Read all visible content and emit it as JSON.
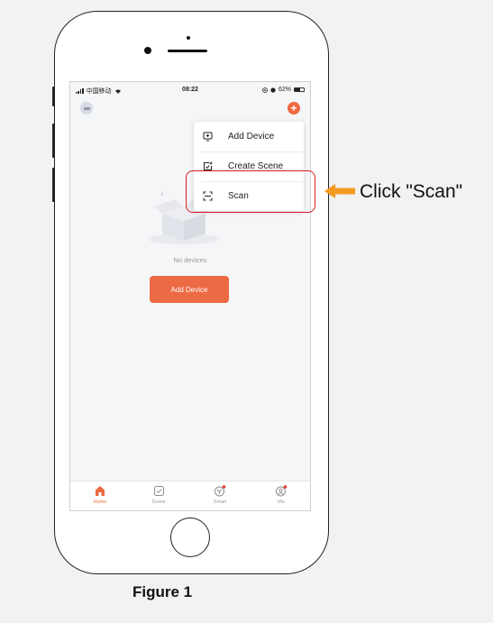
{
  "status_bar": {
    "carrier": "中国移动",
    "time": "08:22",
    "battery": "62%"
  },
  "home": {
    "empty_text": "No devices",
    "add_device_button": "Add Device"
  },
  "menu": {
    "items": [
      {
        "label": "Add Device",
        "icon": "add-device-icon"
      },
      {
        "label": "Create Scene",
        "icon": "create-scene-icon"
      },
      {
        "label": "Scan",
        "icon": "scan-icon"
      }
    ]
  },
  "tabs": [
    {
      "label": "Home",
      "icon": "home-icon",
      "active": true
    },
    {
      "label": "Scene",
      "icon": "scene-icon",
      "active": false
    },
    {
      "label": "Smart",
      "icon": "smart-icon",
      "active": false
    },
    {
      "label": "Me",
      "icon": "me-icon",
      "active": false
    }
  ],
  "annotation": {
    "callout": "Click \"Scan\"",
    "caption": "Figure 1"
  },
  "colors": {
    "accent": "#EC6A44",
    "highlight": "#DC1C22",
    "arrow": "#F39A20"
  }
}
